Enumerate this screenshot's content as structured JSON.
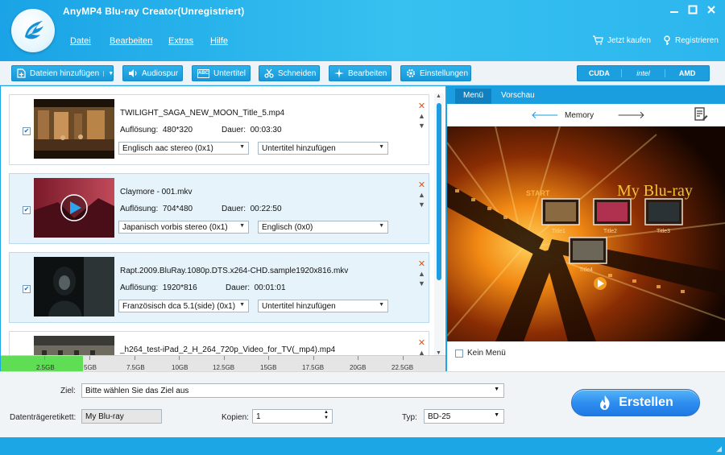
{
  "window": {
    "title": "AnyMP4 Blu-ray Creator(Unregistriert)",
    "controls": [
      "minimize-icon",
      "maximize-icon",
      "close-icon"
    ]
  },
  "menu": [
    "Datei",
    "Bearbeiten",
    "Extras",
    "Hilfe"
  ],
  "top_right": {
    "buy": "Jetzt kaufen",
    "register": "Registrieren"
  },
  "toolbar": {
    "add_files": "Dateien hinzufügen",
    "audio": "Audiospur",
    "subtitle": "Untertitel",
    "cut": "Schneiden",
    "edit": "Bearbeiten",
    "settings": "Einstellungen",
    "accel": [
      "CUDA",
      "intel",
      "AMD"
    ]
  },
  "files": [
    {
      "name": "TWILIGHT_SAGA_NEW_MOON_Title_5.mp4",
      "res_label": "Auflösung:",
      "res": "480*320",
      "dur_label": "Dauer:",
      "dur": "00:03:30",
      "audio": "Englisch aac stereo (0x1)",
      "subtitle": "Untertitel hinzufügen"
    },
    {
      "name": "Claymore - 001.mkv",
      "res_label": "Auflösung:",
      "res": "704*480",
      "dur_label": "Dauer:",
      "dur": "00:22:50",
      "audio": "Japanisch vorbis stereo (0x1)",
      "subtitle": "Englisch (0x0)"
    },
    {
      "name": "Rapt.2009.BluRay.1080p.DTS.x264-CHD.sample1920x816.mkv",
      "res_label": "Auflösung:",
      "res": "1920*816",
      "dur_label": "Dauer:",
      "dur": "00:01:01",
      "audio": "Französisch dca 5.1(side) (0x1)",
      "subtitle": "Untertitel hinzufügen"
    },
    {
      "name": "_h264_test-iPad_2_H_264_720p_Video_for_TV(_mp4).mp4"
    }
  ],
  "sizebar": {
    "ticks": [
      "2.5GB",
      "5GB",
      "7.5GB",
      "10GB",
      "12.5GB",
      "15GB",
      "17.5GB",
      "20GB",
      "22.5GB"
    ],
    "used_fraction": 0.185,
    "fill_color": "#5fdd54"
  },
  "preview": {
    "tabs": [
      "Menü",
      "Vorschau"
    ],
    "template": "Memory",
    "menu_title": "My Blu-ray",
    "start_label": "START",
    "titles": [
      "Title1",
      "Title2",
      "Title3",
      "Title4"
    ],
    "no_menu": "Kein Menü"
  },
  "bottom": {
    "target_label": "Ziel:",
    "target_value": "Bitte wählen Sie das Ziel aus",
    "disc_label": "Datenträgeretikett:",
    "disc_value": "My Blu-ray",
    "copies_label": "Kopien:",
    "copies_value": "1",
    "type_label": "Typ:",
    "type_value": "BD-25",
    "create": "Erstellen"
  },
  "colors": {
    "accent": "#1da6e6",
    "button": "#1a97d8",
    "create": "#2f8ff0"
  }
}
